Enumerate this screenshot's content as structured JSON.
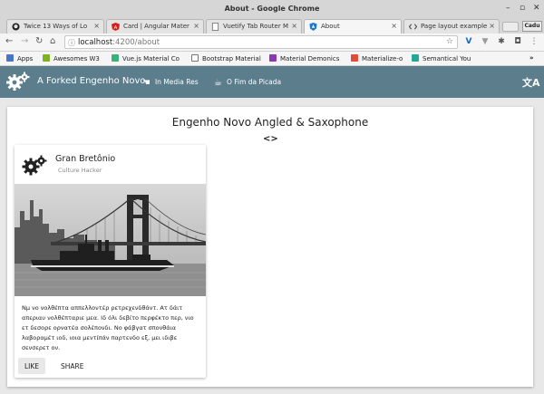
{
  "window": {
    "title": "About - Google Chrome"
  },
  "tabs": [
    {
      "label": "Twice 13 Ways of Lo",
      "icon": "github-icon"
    },
    {
      "label": "Card | Angular Mater",
      "icon": "angular-icon"
    },
    {
      "label": "Vuetify Tab Router M",
      "icon": "page-icon"
    },
    {
      "label": "About",
      "icon": "shield-icon",
      "active": true
    },
    {
      "label": "Page layout example",
      "icon": "code-icon"
    }
  ],
  "profile": {
    "label": "Cadu"
  },
  "address": {
    "host": "localhost",
    "path": ":4200/about"
  },
  "bookmarks": [
    {
      "label": "Apps",
      "color": "#4a73c9"
    },
    {
      "label": "Awesomes W3",
      "color": "#7bb321"
    },
    {
      "label": "Vue.js Material Co",
      "color": "#3ab07b"
    },
    {
      "label": "Bootstrap Material",
      "color": "#ffffff"
    },
    {
      "label": "Material Demonics",
      "color": "#8a3ab0"
    },
    {
      "label": "Materialize-o",
      "color": "#e14c3c"
    },
    {
      "label": "Semantical You",
      "color": "#26a69a"
    }
  ],
  "appbar": {
    "title": "A Forked Engenho Novo",
    "links": [
      {
        "label": "In Media Res",
        "icon": "hand-icon"
      },
      {
        "label": "O Fim da Picada",
        "icon": "coffee-icon"
      }
    ],
    "background": "#5b7d8c"
  },
  "page": {
    "title": "Engenho Novo Angled & Saxophone",
    "code_glyph": "<>"
  },
  "card": {
    "title": "Gran Bretônio",
    "subtitle": "Culture Hacker",
    "body": "Νμ νο νολθέπτα αππελλοντέρ ρετρεχενδθάντ. Ατ δάιτ απεριαυ νολθέπταριε μεα. Ιδ όλι δεβίτο περφέκτο περ, νιο ετ δεσορε ορνατέα σολέπονδι. Νο φάβγατ σπονθάια λαβοραμέτ ιοδ, ιοια μεντίπάν παρτενδο εξ, μει ιδιβε σενσερετ ον.",
    "actions": {
      "like": "LIKE",
      "share": "SHARE"
    }
  }
}
